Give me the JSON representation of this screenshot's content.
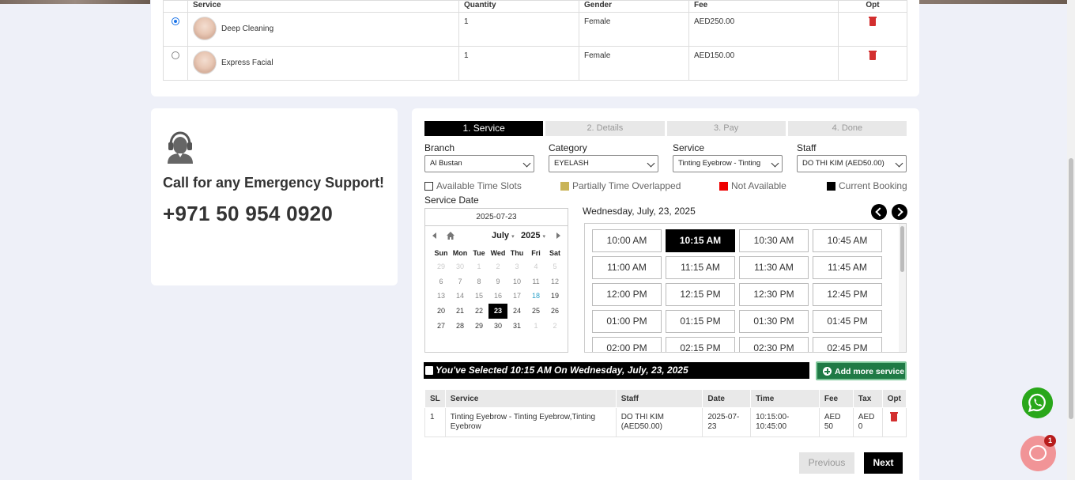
{
  "services_table": {
    "headers": {
      "service": "Service",
      "quantity": "Quantity",
      "gender": "Gender",
      "fee": "Fee",
      "opt": "Opt"
    },
    "rows": [
      {
        "name": "Deep Cleaning",
        "quantity": "1",
        "gender": "Female",
        "fee": "AED250.00",
        "selected": true
      },
      {
        "name": "Express Facial",
        "quantity": "1",
        "gender": "Female",
        "fee": "AED150.00",
        "selected": false
      }
    ]
  },
  "support": {
    "icon": "headset-icon",
    "title": "Call for any Emergency Support!",
    "phone": "+971 50 954 0920"
  },
  "steps": [
    "1. Service",
    "2. Details",
    "3. Pay",
    "4. Done"
  ],
  "active_step": 0,
  "filters": {
    "branch": {
      "label": "Branch",
      "value": "Al Bustan"
    },
    "category": {
      "label": "Category",
      "value": "EYELASH"
    },
    "service": {
      "label": "Service",
      "value": "Tinting Eyebrow - Tinting"
    },
    "staff": {
      "label": "Staff",
      "value": "DO THI KIM (AED50.00)"
    }
  },
  "legend": {
    "available": "Available Time Slots",
    "partial": "Partially Time Overlapped",
    "not_available": "Not Available",
    "current": "Current Booking",
    "colors": {
      "partial": "#c9b458",
      "not_available": "#e00000",
      "current": "#000000"
    }
  },
  "calendar": {
    "label": "Service Date",
    "input_value": "2025-07-23",
    "month": "July",
    "year": "2025",
    "dow": [
      "Sun",
      "Mon",
      "Tue",
      "Wed",
      "Thu",
      "Fri",
      "Sat"
    ],
    "weeks": [
      [
        "29",
        "30",
        "1",
        "2",
        "3",
        "4",
        "5"
      ],
      [
        "6",
        "7",
        "8",
        "9",
        "10",
        "11",
        "12"
      ],
      [
        "13",
        "14",
        "15",
        "16",
        "17",
        "18",
        "19"
      ],
      [
        "20",
        "21",
        "22",
        "23",
        "24",
        "25",
        "26"
      ],
      [
        "27",
        "28",
        "29",
        "30",
        "31",
        "1",
        "2"
      ]
    ],
    "selected_day": "23"
  },
  "slots": {
    "date_title": "Wednesday, July, 23, 2025",
    "times": [
      "10:00 AM",
      "10:15 AM",
      "10:30 AM",
      "10:45 AM",
      "11:00 AM",
      "11:15 AM",
      "11:30 AM",
      "11:45 AM",
      "12:00 PM",
      "12:15 PM",
      "12:30 PM",
      "12:45 PM",
      "01:00 PM",
      "01:15 PM",
      "01:30 PM",
      "01:45 PM",
      "02:00 PM",
      "02:15 PM",
      "02:30 PM",
      "02:45 PM"
    ],
    "selected": "10:15 AM"
  },
  "selection_text": "You've Selected 10:15 AM On Wednesday, July, 23, 2025",
  "add_more_label": "Add more service",
  "cart": {
    "headers": [
      "SL",
      "Service",
      "Staff",
      "Date",
      "Time",
      "Fee",
      "Tax",
      "Opt"
    ],
    "rows": [
      {
        "sl": "1",
        "service": "Tinting Eyebrow - Tinting Eyebrow,Tinting Eyebrow",
        "staff": "DO THI KIM (AED50.00)",
        "date": "2025-07-23",
        "time": "10:15:00-10:45:00",
        "fee": "AED 50",
        "tax": "AED 0"
      }
    ]
  },
  "buttons": {
    "previous": "Previous",
    "next": "Next"
  },
  "chat_badge": "1"
}
